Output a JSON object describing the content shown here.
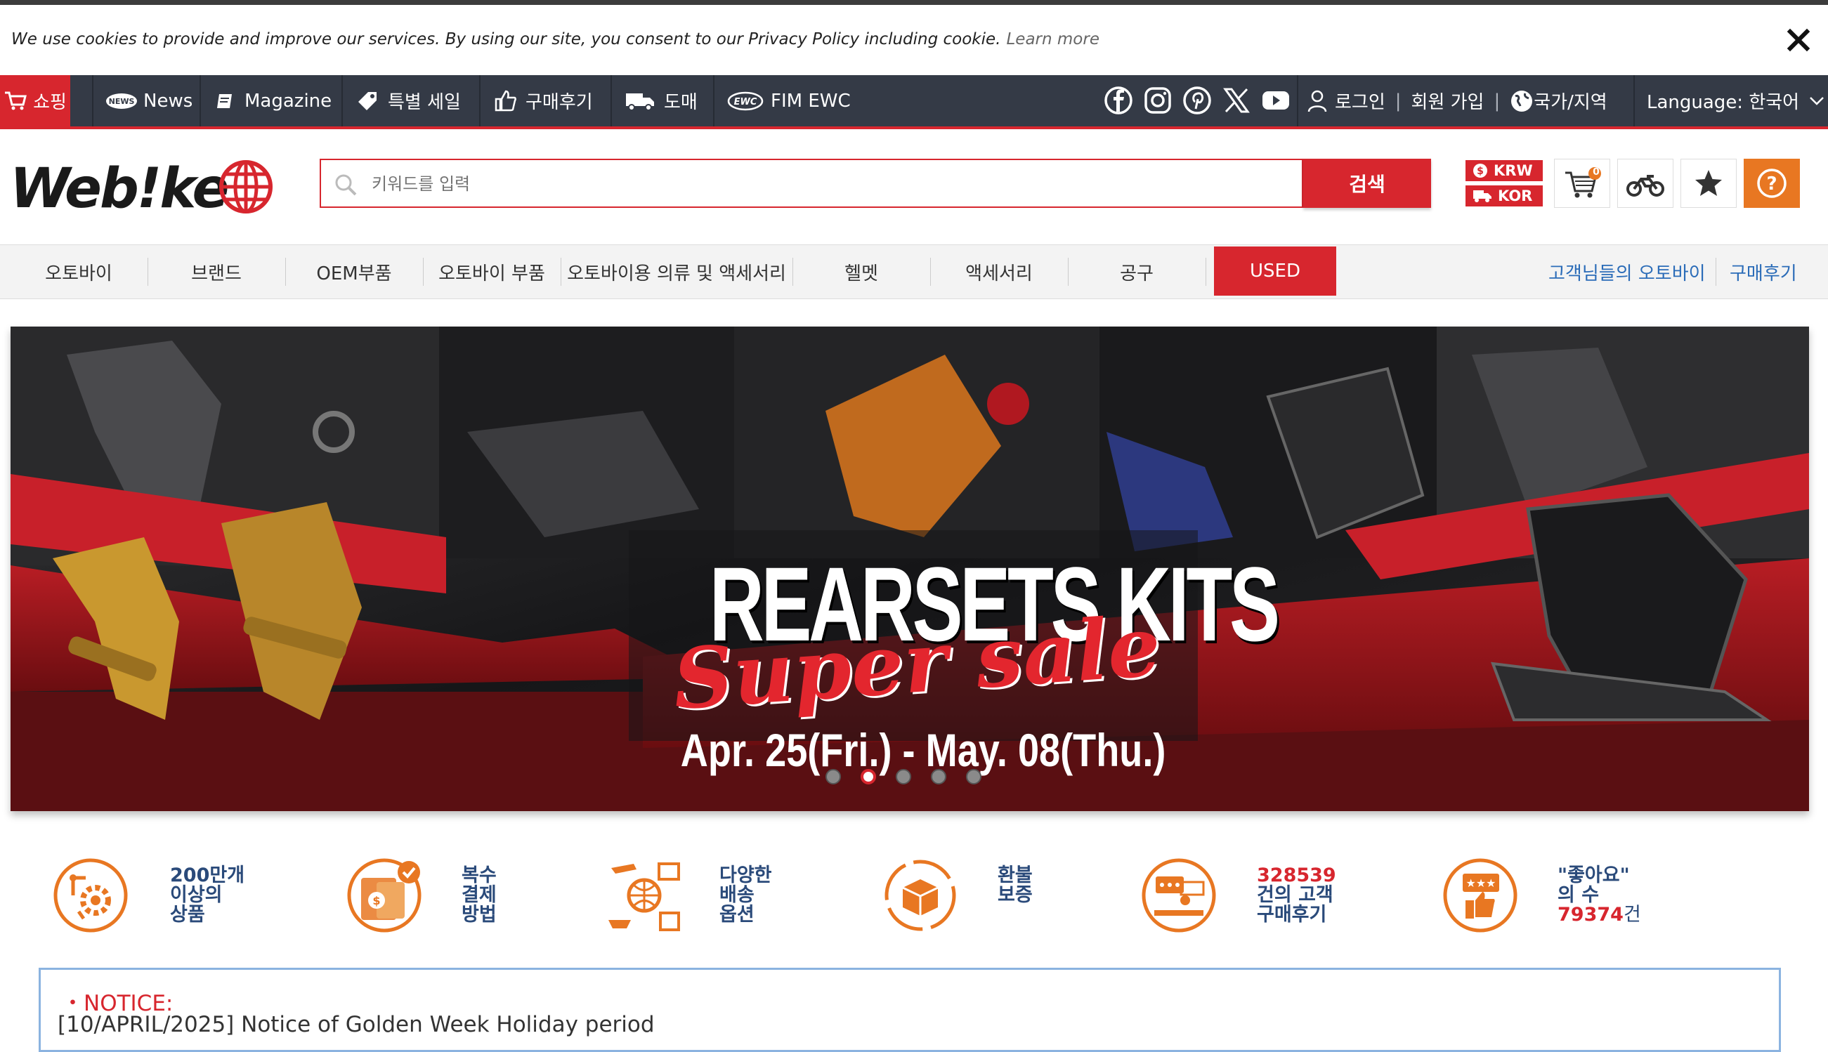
{
  "cookie_bar": {
    "message": "We use cookies to provide and improve our services. By using our site, you consent to our Privacy Policy including cookie.",
    "learn_more": "Learn more"
  },
  "topnav": {
    "shop": "쇼핑",
    "news": "News",
    "magazine": "Magazine",
    "sale": "특별 세일",
    "reviews": "구매후기",
    "wholesale": "도매",
    "ewc": "FIM EWC",
    "login": "로그인",
    "signup": "회원 가입",
    "region": "국가/지역",
    "language": "Language: 한국어",
    "social": [
      "facebook-icon",
      "instagram-icon",
      "pinterest-icon",
      "x-icon",
      "youtube-icon"
    ]
  },
  "header": {
    "logo_text": "Web!ke",
    "search_placeholder": "키워드를 입력",
    "search_button": "검색",
    "currency": "KRW",
    "country": "KOR",
    "cart_count": "0"
  },
  "catnav": {
    "items": [
      "오토바이",
      "브랜드",
      "OEM부품",
      "오토바이 부품",
      "오토바이용 의류 및 액세서리",
      "헬멧",
      "액세서리",
      "공구",
      "USED"
    ],
    "right_links": [
      "고객님들의 오토바이",
      "구매후기"
    ]
  },
  "banner": {
    "headline": "REARSETS KITS",
    "script": "Super sale",
    "dates": "Apr. 25(Fri.) - May. 08(Thu.)",
    "slide_count": 5,
    "active_slide": 2
  },
  "features": [
    {
      "lines": [
        "200만개",
        "이상의",
        "상품"
      ]
    },
    {
      "lines": [
        "복수",
        "결제",
        "방법"
      ]
    },
    {
      "lines": [
        "다양한",
        "배송",
        "옵션"
      ]
    },
    {
      "lines": [
        "환불",
        "보증"
      ]
    },
    {
      "lines": [
        "328539",
        "건의 고객",
        "구매후기"
      ]
    },
    {
      "lines": [
        "\"좋아요\"",
        "의 수",
        "79374",
        "건"
      ]
    }
  ],
  "notice": {
    "title": "・NOTICE:",
    "text": "[10/APRIL/2025] Notice of Golden Week Holiday period"
  },
  "colors": {
    "brand_red": "#d7262e",
    "nav_dark": "#343a46",
    "link_blue": "#2b6cb8",
    "feature_orange": "#e87722"
  }
}
